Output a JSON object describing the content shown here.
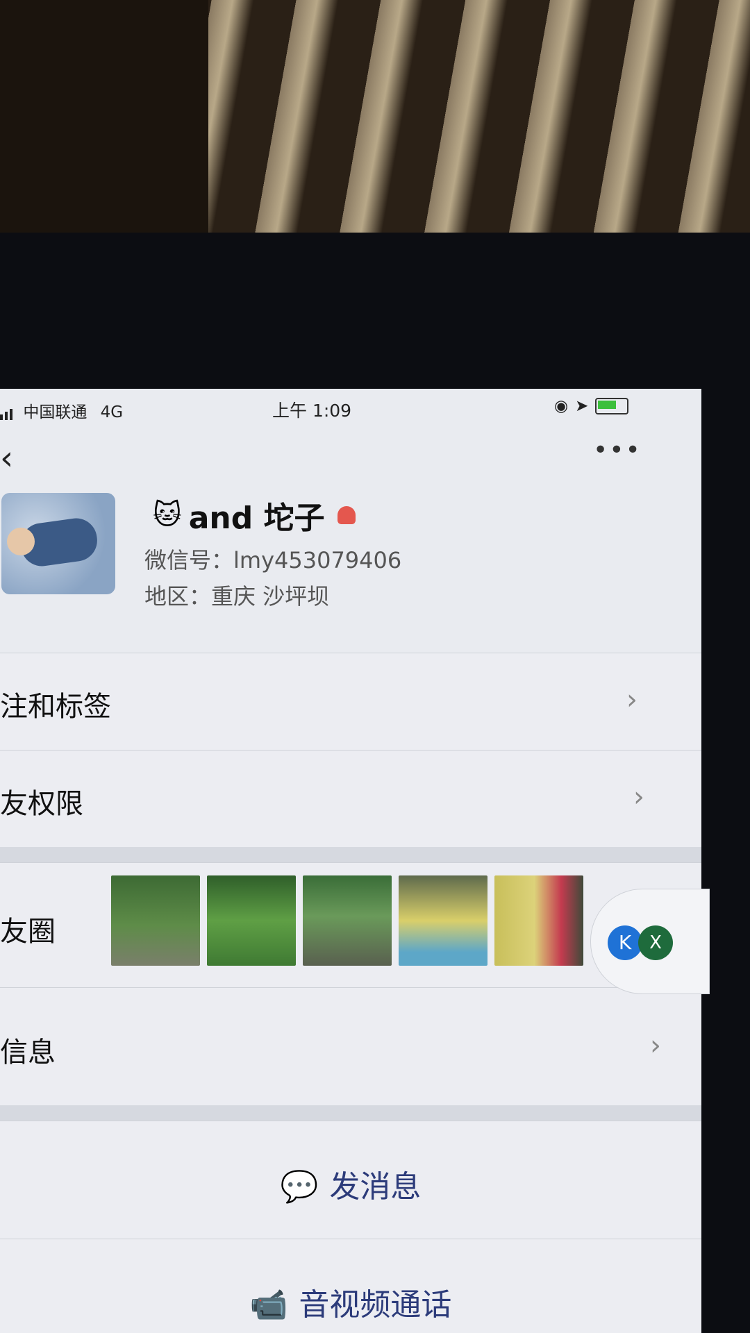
{
  "status": {
    "carrier": "中国联通",
    "network": "4G",
    "time": "上午 1:09"
  },
  "profile": {
    "name": "and 坨子",
    "wechat_id": "微信号：lmy453079406",
    "region": "地区：重庆 沙坪坝"
  },
  "menu": {
    "remark_label": "注和标签",
    "permission_label": "友权限",
    "moments_label": "友圈",
    "more_info_label": "信息"
  },
  "float_button": {
    "k_label": "K",
    "x_label": "X"
  },
  "actions": {
    "message_label": "发消息",
    "call_label": "音视频通话"
  }
}
